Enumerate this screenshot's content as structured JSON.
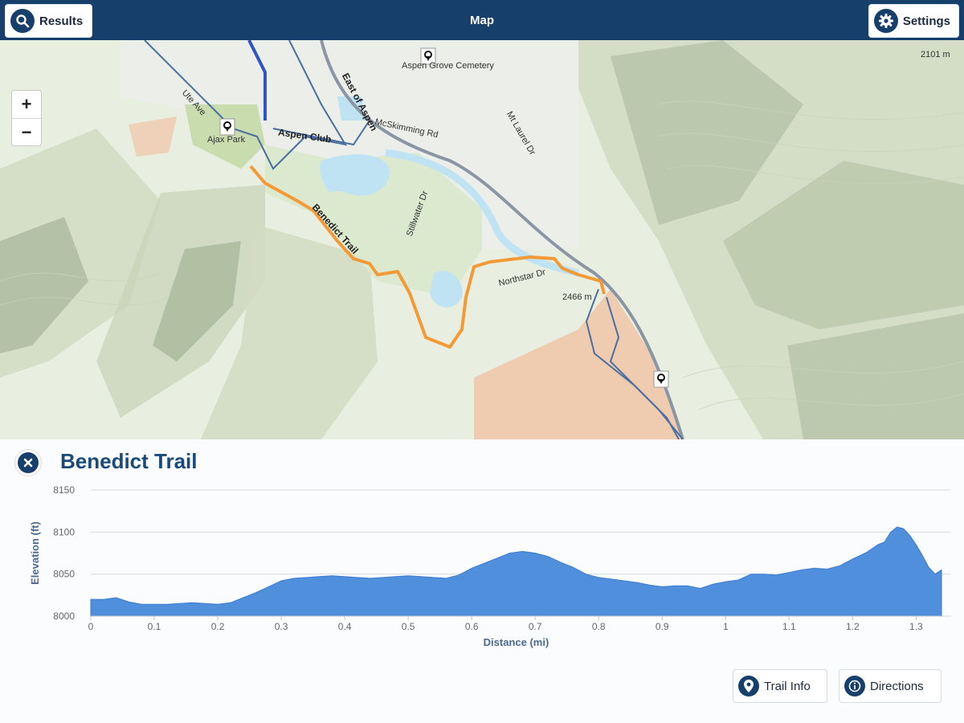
{
  "header": {
    "title": "Map",
    "results_label": "Results",
    "settings_label": "Settings"
  },
  "map": {
    "zoom_in": "+",
    "zoom_out": "−",
    "labels": {
      "ute_ave": "Ute Ave",
      "east_of_aspen": "East of Aspen",
      "aspen_club": "Aspen Club",
      "benedict_trail": "Benedict Trail",
      "ajax_park": "Ajax Park",
      "cemetery": "Aspen Grove Cemetery",
      "stillwater": "Stillwater Dr",
      "northstar": "Northstar Dr",
      "elevation_marker": "2466 m",
      "elevation_marker_top": "2101 m",
      "mcskimming": "McSkimming Rd",
      "mt_laurel": "Mt Laurel Dr"
    },
    "trail_color": "#f39a36",
    "route_color": "#4a6fa0"
  },
  "panel": {
    "trail_name": "Benedict Trail",
    "trail_info_label": "Trail Info",
    "directions_label": "Directions"
  },
  "chart_data": {
    "type": "area",
    "xlabel": "Distance (mi)",
    "ylabel": "Elevation (ft)",
    "xlim": [
      0,
      1.34
    ],
    "ylim": [
      8000,
      8150
    ],
    "x_ticks": [
      "0",
      "0.1",
      "0.2",
      "0.3",
      "0.4",
      "0.5",
      "0.6",
      "0.7",
      "0.8",
      "0.9",
      "1",
      "1.1",
      "1.2",
      "1.3"
    ],
    "y_ticks": [
      "8000",
      "8050",
      "8100",
      "8150"
    ],
    "grid": true,
    "fill_color": "#4f8fdb",
    "series": [
      {
        "x": [
          0,
          0.02,
          0.04,
          0.06,
          0.08,
          0.1,
          0.12,
          0.14,
          0.16,
          0.18,
          0.2,
          0.22,
          0.24,
          0.26,
          0.28,
          0.3,
          0.32,
          0.34,
          0.36,
          0.38,
          0.4,
          0.42,
          0.44,
          0.46,
          0.48,
          0.5,
          0.52,
          0.54,
          0.56,
          0.58,
          0.6,
          0.62,
          0.64,
          0.66,
          0.68,
          0.7,
          0.72,
          0.74,
          0.76,
          0.78,
          0.8,
          0.82,
          0.84,
          0.86,
          0.88,
          0.9,
          0.92,
          0.94,
          0.96,
          0.98,
          1.0,
          1.02,
          1.04,
          1.06,
          1.08,
          1.1,
          1.12,
          1.14,
          1.16,
          1.18,
          1.2,
          1.22,
          1.24,
          1.25,
          1.26,
          1.27,
          1.28,
          1.29,
          1.3,
          1.31,
          1.32,
          1.33,
          1.34
        ],
        "y": [
          8020,
          8020,
          8022,
          8017,
          8014,
          8014,
          8014,
          8015,
          8016,
          8015,
          8014,
          8016,
          8022,
          8028,
          8035,
          8042,
          8045,
          8046,
          8047,
          8048,
          8047,
          8046,
          8045,
          8046,
          8047,
          8048,
          8047,
          8046,
          8045,
          8049,
          8057,
          8063,
          8069,
          8075,
          8077,
          8075,
          8071,
          8064,
          8058,
          8050,
          8046,
          8044,
          8042,
          8040,
          8037,
          8035,
          8036,
          8036,
          8033,
          8038,
          8041,
          8043,
          8050,
          8050,
          8049,
          8052,
          8055,
          8057,
          8056,
          8060,
          8068,
          8075,
          8085,
          8088,
          8100,
          8106,
          8104,
          8096,
          8085,
          8072,
          8058,
          8050,
          8055
        ]
      }
    ]
  }
}
